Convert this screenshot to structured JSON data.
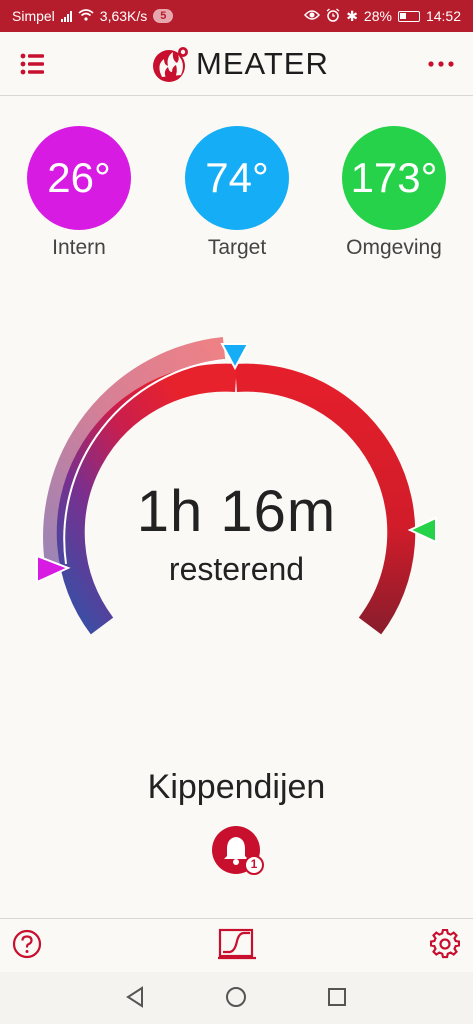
{
  "status_bar": {
    "carrier": "Simpel",
    "speed": "3,63K/s",
    "notification_count": "5",
    "battery": "28%",
    "time": "14:52"
  },
  "app": {
    "title": "MEATER"
  },
  "temperatures": [
    {
      "value": "26°",
      "label": "Intern",
      "color": "#d81be3"
    },
    {
      "value": "74°",
      "label": "Target",
      "color": "#15adf5"
    },
    {
      "value": "173°",
      "label": "Omgeving",
      "color": "#25d249"
    }
  ],
  "cook": {
    "time_remaining": "1h 16m",
    "remaining_label": "resterend",
    "food": "Kippendijen",
    "alarm_count": "1"
  },
  "colors": {
    "brand": "#c8102e",
    "status_bar": "#b51d2c"
  },
  "icons": {
    "menu": "menu-icon",
    "more": "more-icon",
    "help": "help-icon",
    "graph": "graph-icon",
    "settings": "gear-icon",
    "alarm": "bell-icon"
  }
}
